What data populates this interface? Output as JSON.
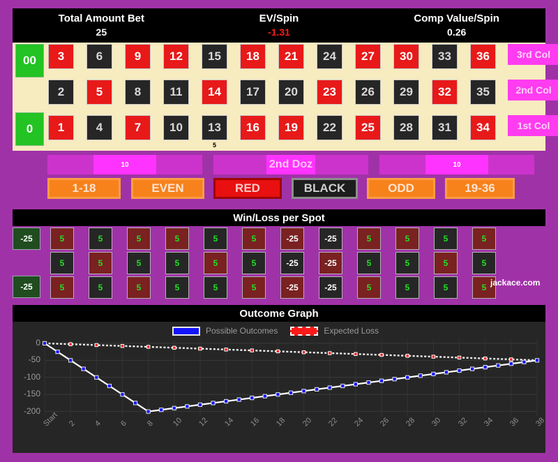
{
  "stats": [
    {
      "label": "Total Amount Bet",
      "value": "25",
      "negative": false
    },
    {
      "label": "EV/Spin",
      "value": "-1.31",
      "negative": true
    },
    {
      "label": "Comp Value/Spin",
      "value": "0.26",
      "negative": false
    }
  ],
  "board": {
    "zeros": [
      {
        "label": "00"
      },
      {
        "label": "0"
      }
    ],
    "rows": [
      {
        "numbers": [
          {
            "n": "3",
            "color": "red"
          },
          {
            "n": "6",
            "color": "black"
          },
          {
            "n": "9",
            "color": "red"
          },
          {
            "n": "12",
            "color": "red"
          },
          {
            "n": "15",
            "color": "black"
          },
          {
            "n": "18",
            "color": "red"
          },
          {
            "n": "21",
            "color": "red"
          },
          {
            "n": "24",
            "color": "black"
          },
          {
            "n": "27",
            "color": "red"
          },
          {
            "n": "30",
            "color": "red"
          },
          {
            "n": "33",
            "color": "black"
          },
          {
            "n": "36",
            "color": "red"
          }
        ]
      },
      {
        "numbers": [
          {
            "n": "2",
            "color": "black"
          },
          {
            "n": "5",
            "color": "red"
          },
          {
            "n": "8",
            "color": "black"
          },
          {
            "n": "11",
            "color": "black"
          },
          {
            "n": "14",
            "color": "red"
          },
          {
            "n": "17",
            "color": "black"
          },
          {
            "n": "20",
            "color": "black"
          },
          {
            "n": "23",
            "color": "red"
          },
          {
            "n": "26",
            "color": "black"
          },
          {
            "n": "29",
            "color": "black"
          },
          {
            "n": "32",
            "color": "red"
          },
          {
            "n": "35",
            "color": "black"
          }
        ]
      },
      {
        "numbers": [
          {
            "n": "1",
            "color": "red"
          },
          {
            "n": "4",
            "color": "black"
          },
          {
            "n": "7",
            "color": "red"
          },
          {
            "n": "10",
            "color": "black"
          },
          {
            "n": "13",
            "color": "black"
          },
          {
            "n": "16",
            "color": "red"
          },
          {
            "n": "19",
            "color": "red"
          },
          {
            "n": "22",
            "color": "black"
          },
          {
            "n": "25",
            "color": "red"
          },
          {
            "n": "28",
            "color": "black"
          },
          {
            "n": "31",
            "color": "black"
          },
          {
            "n": "34",
            "color": "red"
          }
        ]
      }
    ],
    "columns": [
      {
        "label": "3rd Col"
      },
      {
        "label": "2nd Col"
      },
      {
        "label": "1st Col"
      }
    ],
    "board_chip": {
      "amount": "5"
    }
  },
  "dozens": [
    {
      "label": "",
      "chip": "10"
    },
    {
      "label": "2nd Doz",
      "chip": ""
    },
    {
      "label": "",
      "chip": "10"
    }
  ],
  "outside": [
    {
      "label": "1-18",
      "style": "orange"
    },
    {
      "label": "EVEN",
      "style": "orange"
    },
    {
      "label": "RED",
      "style": "red"
    },
    {
      "label": "BLACK",
      "style": "black"
    },
    {
      "label": "ODD",
      "style": "orange"
    },
    {
      "label": "19-36",
      "style": "orange"
    }
  ],
  "winloss": {
    "title": "Win/Loss per Spot",
    "zeros": [
      {
        "label": "-25"
      },
      {
        "label": "-25"
      }
    ],
    "rows": [
      {
        "cells": [
          {
            "v": "5",
            "color": "rd",
            "kind": "win"
          },
          {
            "v": "5",
            "color": "bk",
            "kind": "win"
          },
          {
            "v": "5",
            "color": "rd",
            "kind": "win"
          },
          {
            "v": "5",
            "color": "rd",
            "kind": "win"
          },
          {
            "v": "5",
            "color": "bk",
            "kind": "win"
          },
          {
            "v": "5",
            "color": "rd",
            "kind": "win"
          },
          {
            "v": "-25",
            "color": "rd",
            "kind": "loss"
          },
          {
            "v": "-25",
            "color": "bk",
            "kind": "loss"
          },
          {
            "v": "5",
            "color": "rd",
            "kind": "win"
          },
          {
            "v": "5",
            "color": "rd",
            "kind": "win"
          },
          {
            "v": "5",
            "color": "bk",
            "kind": "win"
          },
          {
            "v": "5",
            "color": "rd",
            "kind": "win"
          }
        ]
      },
      {
        "cells": [
          {
            "v": "5",
            "color": "bk",
            "kind": "win"
          },
          {
            "v": "5",
            "color": "rd",
            "kind": "win"
          },
          {
            "v": "5",
            "color": "bk",
            "kind": "win"
          },
          {
            "v": "5",
            "color": "bk",
            "kind": "win"
          },
          {
            "v": "5",
            "color": "rd",
            "kind": "win"
          },
          {
            "v": "5",
            "color": "bk",
            "kind": "win"
          },
          {
            "v": "-25",
            "color": "bk",
            "kind": "loss"
          },
          {
            "v": "-25",
            "color": "rd",
            "kind": "loss"
          },
          {
            "v": "5",
            "color": "bk",
            "kind": "win"
          },
          {
            "v": "5",
            "color": "bk",
            "kind": "win"
          },
          {
            "v": "5",
            "color": "rd",
            "kind": "win"
          },
          {
            "v": "5",
            "color": "bk",
            "kind": "win"
          }
        ]
      },
      {
        "cells": [
          {
            "v": "5",
            "color": "rd",
            "kind": "win"
          },
          {
            "v": "5",
            "color": "bk",
            "kind": "win"
          },
          {
            "v": "5",
            "color": "rd",
            "kind": "win"
          },
          {
            "v": "5",
            "color": "bk",
            "kind": "win"
          },
          {
            "v": "5",
            "color": "bk",
            "kind": "win"
          },
          {
            "v": "5",
            "color": "rd",
            "kind": "win"
          },
          {
            "v": "-25",
            "color": "rd",
            "kind": "loss"
          },
          {
            "v": "-25",
            "color": "bk",
            "kind": "loss"
          },
          {
            "v": "5",
            "color": "rd",
            "kind": "win"
          },
          {
            "v": "5",
            "color": "bk",
            "kind": "win"
          },
          {
            "v": "5",
            "color": "bk",
            "kind": "win"
          },
          {
            "v": "5",
            "color": "rd",
            "kind": "win"
          }
        ]
      }
    ],
    "brand": "jackace.com"
  },
  "chart_data": {
    "type": "line",
    "title": "Outcome Graph",
    "xlabel": "",
    "ylabel": "",
    "ylim": [
      -215,
      10
    ],
    "yticks": [
      0,
      -50,
      -100,
      -150,
      -200
    ],
    "grid": true,
    "legend_position": "top-center",
    "legend": [
      {
        "name": "Possible Outcomes",
        "color": "#1414ff",
        "style": "solid"
      },
      {
        "name": "Expected Loss",
        "color": "#ff1a1a",
        "style": "dashed"
      }
    ],
    "xticks": [
      "Start",
      "2",
      "4",
      "6",
      "8",
      "10",
      "12",
      "14",
      "16",
      "18",
      "20",
      "22",
      "24",
      "26",
      "28",
      "30",
      "32",
      "34",
      "36",
      "38"
    ],
    "x": [
      0,
      1,
      2,
      3,
      4,
      5,
      6,
      7,
      8,
      9,
      10,
      11,
      12,
      13,
      14,
      15,
      16,
      17,
      18,
      19,
      20,
      21,
      22,
      23,
      24,
      25,
      26,
      27,
      28,
      29,
      30,
      31,
      32,
      33,
      34,
      35,
      36,
      37,
      38
    ],
    "series": [
      {
        "name": "Possible Outcomes",
        "color": "#1414ff",
        "style": "solid",
        "values": [
          0,
          -25,
          -50,
          -75,
          -100,
          -125,
          -150,
          -175,
          -200,
          -195,
          -190,
          -185,
          -180,
          -175,
          -170,
          -165,
          -160,
          -155,
          -150,
          -145,
          -140,
          -135,
          -130,
          -125,
          -120,
          -115,
          -110,
          -105,
          -100,
          -95,
          -90,
          -85,
          -80,
          -75,
          -70,
          -65,
          -60,
          -55,
          -50
        ]
      },
      {
        "name": "Expected Loss",
        "color": "#ff1a1a",
        "style": "dashed",
        "values": [
          0,
          -1.31,
          -2.62,
          -3.93,
          -5.24,
          -6.55,
          -7.86,
          -9.17,
          -10.48,
          -11.79,
          -13.1,
          -14.41,
          -15.72,
          -17.03,
          -18.34,
          -19.65,
          -20.96,
          -22.27,
          -23.58,
          -24.89,
          -26.2,
          -27.51,
          -28.82,
          -30.13,
          -31.44,
          -32.75,
          -34.06,
          -35.37,
          -36.68,
          -37.99,
          -39.3,
          -40.61,
          -41.92,
          -43.23,
          -44.54,
          -45.85,
          -47.16,
          -48.47,
          -49.78
        ]
      }
    ]
  }
}
